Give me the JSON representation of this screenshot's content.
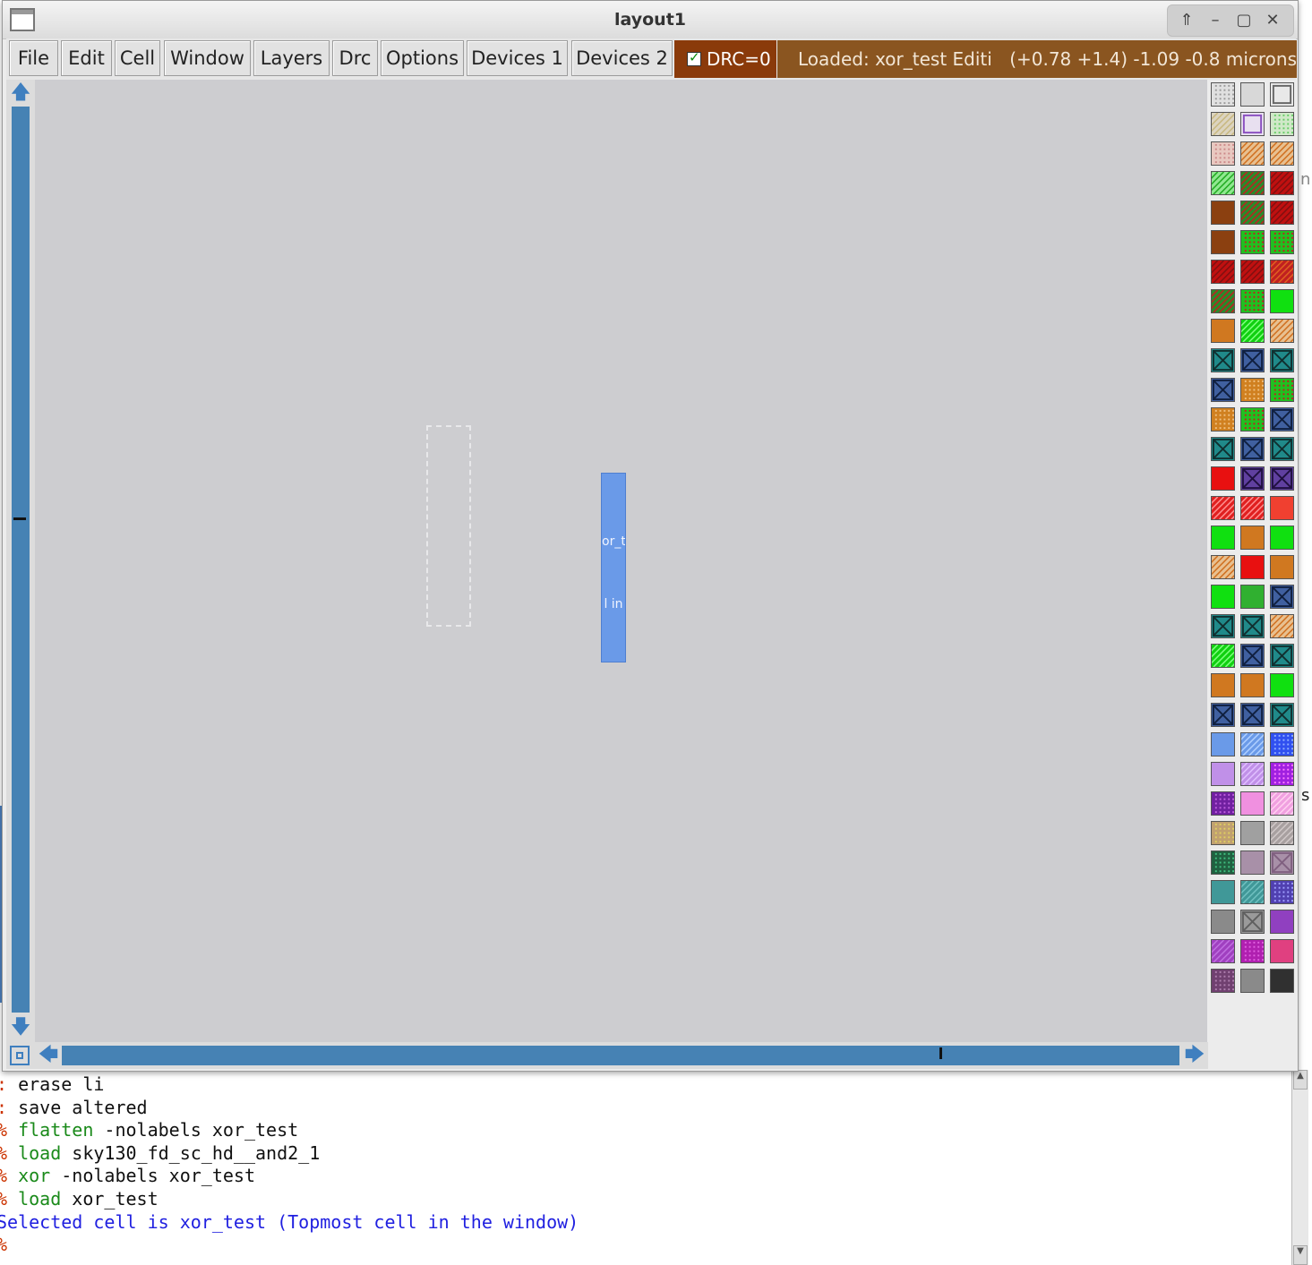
{
  "window": {
    "title": "layout1"
  },
  "menu": {
    "items": [
      {
        "label": "File"
      },
      {
        "label": "Edit"
      },
      {
        "label": "Cell"
      },
      {
        "label": "Window"
      },
      {
        "label": "Layers"
      },
      {
        "label": "Drc"
      },
      {
        "label": "Options"
      },
      {
        "label": "Devices 1"
      },
      {
        "label": "Devices 2"
      }
    ],
    "drc_label": "DRC=0",
    "drc_checked": true,
    "status_loaded": "Loaded: xor_test Editi",
    "status_coords": "(+0.78 +1.4) -1.09 -0.8 microns"
  },
  "canvas": {
    "cell_label_top": "or_te",
    "cell_label_bottom": "l in",
    "colors": {
      "background": "#cdcdd0",
      "cell_fill": "#6a9ae8"
    }
  },
  "console": {
    "lines": [
      {
        "prompt": ":",
        "cmd": "",
        "rest": " erase li"
      },
      {
        "prompt": ":",
        "cmd": "",
        "rest": " save altered"
      },
      {
        "prompt": "%",
        "cmd": " flatten",
        "rest": " -nolabels xor_test"
      },
      {
        "prompt": "%",
        "cmd": " load",
        "rest": " sky130_fd_sc_hd__and2_1"
      },
      {
        "prompt": "%",
        "cmd": " xor",
        "rest": " -nolabels xor_test"
      },
      {
        "prompt": "%",
        "cmd": " load",
        "rest": " xor_test"
      }
    ],
    "message": "Selected cell is xor_test (Topmost cell in the window)",
    "final_prompt": "%"
  },
  "palette_icons": [
    "layer-swatch"
  ]
}
